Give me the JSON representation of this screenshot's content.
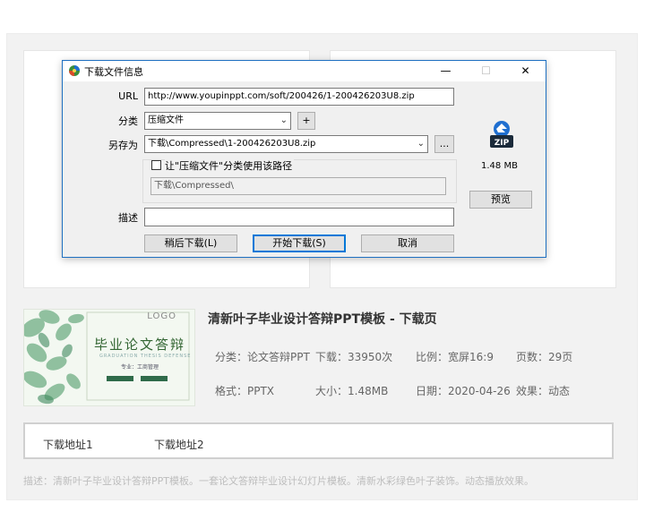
{
  "page": {
    "title": "清新叶子毕业设计答辩PPT模板 - 下载页",
    "meta": {
      "category": "分类：论文答辩PPT",
      "downloads": "下载：33950次",
      "ratio": "比例：宽屏16:9",
      "pages": "页数：29页",
      "format": "格式：PPTX",
      "size": "大小：1.48MB",
      "date": "日期：2020-04-26",
      "effect": "效果：动态"
    },
    "download_links": [
      "下载地址1",
      "下载地址2"
    ],
    "description": "描述：清新叶子毕业设计答辩PPT模板。一套论文答辩毕业设计幻灯片模板。清新水彩绿色叶子装饰。动态播放效果。",
    "thumbnail": {
      "logo": "LOGO",
      "title": "毕业论文答辩",
      "subtitle": "GRADUATION THESIS DEFENSE",
      "line2": "专业：工商管理"
    }
  },
  "dialog": {
    "title": "下载文件信息",
    "url_label": "URL",
    "url_value": "http://www.youpinppt.com/soft/200426/1-200426203U8.zip",
    "category_label": "分类",
    "category_value": "压缩文件",
    "add_button": "+",
    "saveas_label": "另存为",
    "saveas_value": "下载\\Compressed\\1-200426203U8.zip",
    "browse_button": "...",
    "remember_checkbox": "让\"压缩文件\"分类使用该路径",
    "path_value": "下载\\Compressed\\",
    "desc_label": "描述",
    "desc_value": "",
    "file_size": "1.48 MB",
    "zip_icon_text": "ZIP",
    "preview_button": "预览",
    "later_button": "稍后下载(L)",
    "start_button": "开始下载(S)",
    "cancel_button": "取消"
  },
  "colors": {
    "accent": "#0078d7",
    "titlebar_border": "#1f70c1",
    "zip_icon_blue": "#1f6fd0",
    "zip_icon_dark": "#1a2a3a"
  }
}
